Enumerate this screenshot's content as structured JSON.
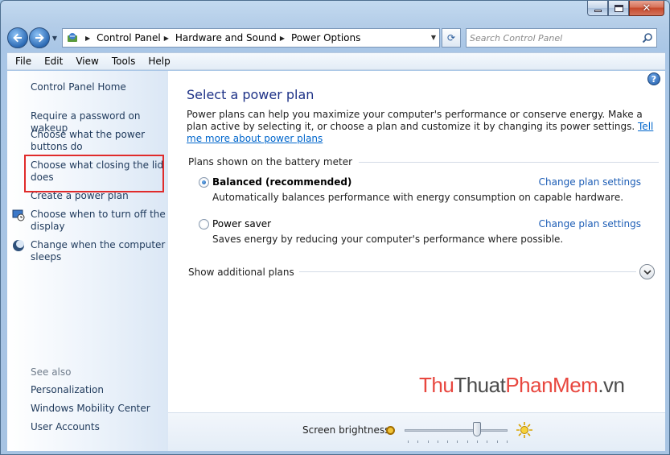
{
  "window": {
    "caption_buttons": [
      "minimize",
      "maximize",
      "close"
    ]
  },
  "address_bar": {
    "breadcrumbs": [
      "Control Panel",
      "Hardware and Sound",
      "Power Options"
    ],
    "search_placeholder": "Search Control Panel"
  },
  "menu": {
    "items": [
      "File",
      "Edit",
      "View",
      "Tools",
      "Help"
    ]
  },
  "sidebar": {
    "home": "Control Panel Home",
    "links": [
      "Require a password on wakeup",
      "Choose what the power buttons do",
      "Choose what closing the lid does",
      "Create a power plan",
      "Choose when to turn off the display",
      "Change when the computer sleeps"
    ],
    "see_also_heading": "See also",
    "see_also": [
      "Personalization",
      "Windows Mobility Center",
      "User Accounts"
    ]
  },
  "main": {
    "help": "?",
    "title": "Select a power plan",
    "description": "Power plans can help you maximize your computer's performance or conserve energy. Make a plan active by selecting it, or choose a plan and customize it by changing its power settings.",
    "description_link": "Tell me more about power plans",
    "section_label": "Plans shown on the battery meter",
    "plans": [
      {
        "name": "Balanced (recommended)",
        "description": "Automatically balances performance with energy consumption on capable hardware.",
        "change_link": "Change plan settings",
        "selected": true
      },
      {
        "name": "Power saver",
        "description": "Saves energy by reducing your computer's performance where possible.",
        "change_link": "Change plan settings",
        "selected": false
      }
    ],
    "additional_plans": "Show additional plans"
  },
  "brightness": {
    "label": "Screen brightness:",
    "level_fraction": 0.72
  },
  "watermark": {
    "part1": "Thu",
    "part2": "Thuat",
    "part3": "PhanMem",
    "part4": ".vn"
  },
  "colors": {
    "title_blue": "#1e3287",
    "link_blue": "#1b5cb5",
    "sidebar_link": "#1e395b",
    "highlight_red": "#e02b2b"
  }
}
